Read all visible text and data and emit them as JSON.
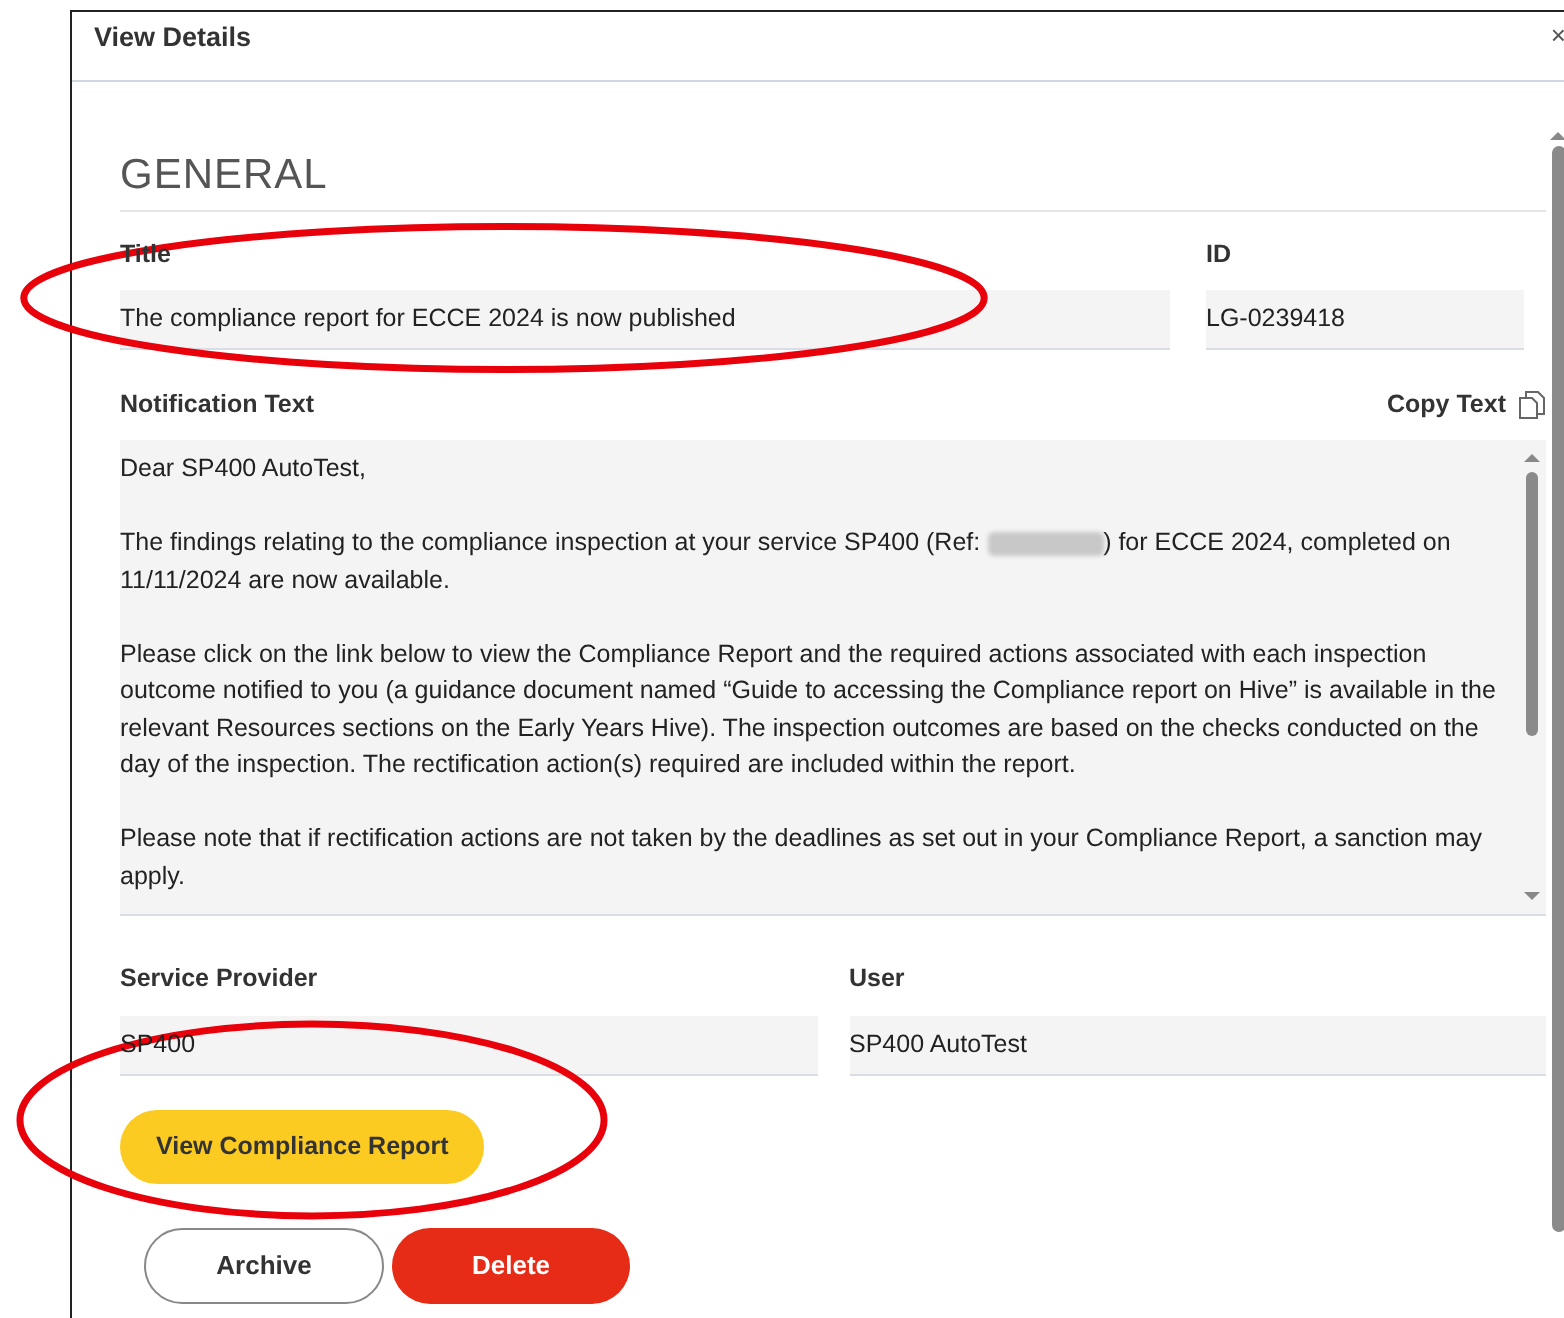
{
  "dialog": {
    "title": "View Details",
    "close": "×"
  },
  "section": {
    "heading": "GENERAL"
  },
  "fields": [
    {
      "label": "Title",
      "value": "The compliance report for ECCE 2024 is now published"
    },
    {
      "label": "ID",
      "value": "LG-0239418"
    }
  ],
  "notification": {
    "label": "Notification Text",
    "copy_action": "Copy Text",
    "paragraphs": [
      {
        "parts": [
          "Dear SP400 AutoTest,"
        ]
      },
      {
        "parts": [
          "The findings relating to the compliance inspection at your service SP400 (Ref: ",
          ") for ECCE 2024, completed on 11/11/2024 are now available."
        ]
      },
      {
        "parts": [
          "Please click on the link below to view the Compliance Report and the required actions associated with each inspection outcome notified to you (a guidance document named “Guide to accessing the Compliance report on Hive” is available in the relevant Resources sections on the Early Years Hive). The inspection outcomes are based on the checks conducted on the day of the inspection. The rectification action(s) required are included within the report."
        ]
      },
      {
        "parts": [
          "Please note that if rectification actions are not taken by the deadlines as set out in your Compliance Report, a sanction may apply."
        ]
      }
    ]
  },
  "bottom_fields": [
    {
      "label": "Service Provider",
      "value": "SP400"
    },
    {
      "label": "User",
      "value": "SP400 AutoTest"
    }
  ],
  "primary_button": "View Compliance Report",
  "actions": [
    {
      "kind": "outline",
      "label": "Archive"
    },
    {
      "kind": "danger",
      "label": "Delete"
    }
  ],
  "annotations": [
    {
      "kind": "ellipse"
    },
    {
      "kind": "ellipse"
    }
  ]
}
